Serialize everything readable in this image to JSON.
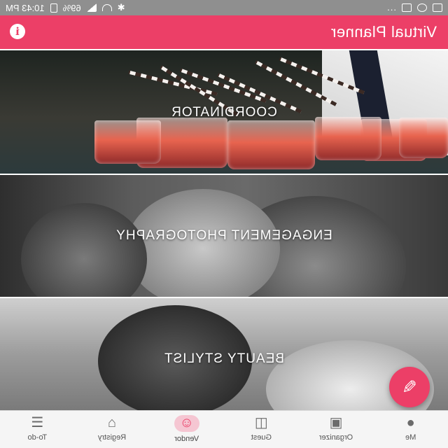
{
  "status_bar": {
    "time": "10:43 PM",
    "battery": "69%",
    "overflow": "..."
  },
  "app_bar": {
    "title": "Virtual Planner",
    "info_icon": "info-icon"
  },
  "categories": [
    {
      "label": "COORDINATOR",
      "image": "cocktail-glasses-photo"
    },
    {
      "label": "ENGAGEMENT PHOTOGRAPHY",
      "image": "engagement-ring-couple-photo"
    },
    {
      "label": "BEAUTY STYLIST",
      "image": "bridal-hair-styling-photo"
    }
  ],
  "fab": {
    "icon": "pencil-icon"
  },
  "bottom_nav": {
    "items": [
      {
        "label": "To-do",
        "icon": "checklist-icon"
      },
      {
        "label": "Registry",
        "icon": "gift-icon"
      },
      {
        "label": "Vendor",
        "icon": "vendor-icon",
        "active": true
      },
      {
        "label": "Guest",
        "icon": "guests-icon"
      },
      {
        "label": "Organizer",
        "icon": "organizer-icon"
      },
      {
        "label": "Me",
        "icon": "person-icon"
      }
    ]
  },
  "colors": {
    "accent": "#ec3f67",
    "status_bar": "#8f8f8f",
    "nav_bg": "#f5f5f5"
  }
}
